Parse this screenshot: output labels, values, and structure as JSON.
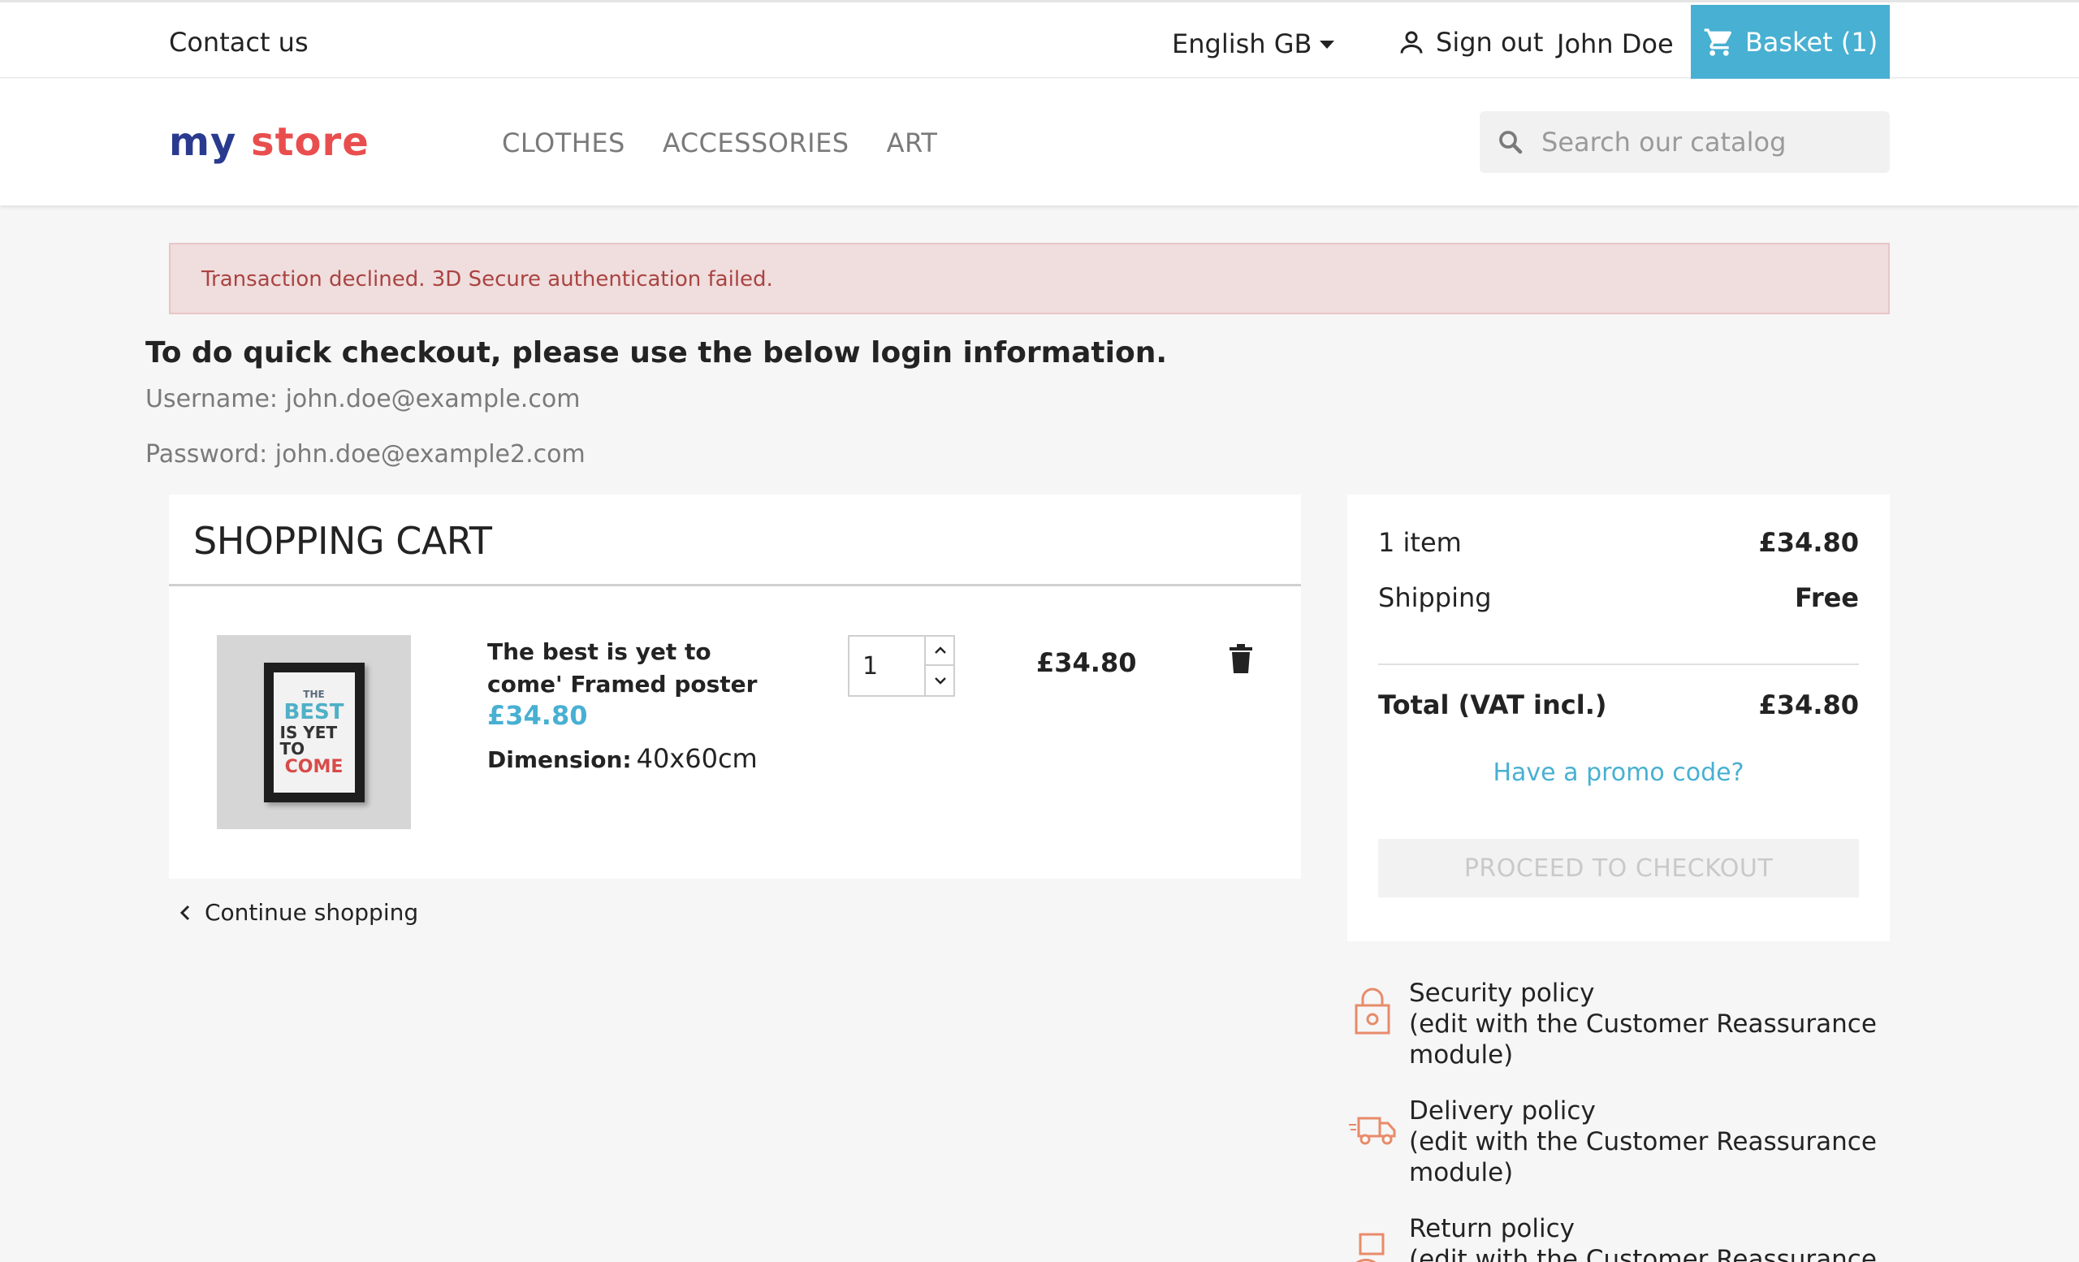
{
  "topbar": {
    "contact": "Contact us",
    "language": "English GB",
    "sign_out": "Sign out",
    "user_name": "John Doe",
    "basket": "Basket (1)"
  },
  "header": {
    "logo_part1": "my",
    "logo_part2": "store",
    "nav": [
      "CLOTHES",
      "ACCESSORIES",
      "ART"
    ],
    "search_placeholder": "Search our catalog"
  },
  "alert": {
    "message": "Transaction declined. 3D Secure authentication failed."
  },
  "quick_checkout": {
    "title": "To do quick checkout, please use the below login information.",
    "username": "Username: john.doe@example.com",
    "password": "Password: john.doe@example2.com"
  },
  "cart": {
    "title": "SHOPPING CART",
    "item": {
      "name": "The best is yet to come' Framed poster",
      "price": "£34.80",
      "dimension_label": "Dimension:",
      "dimension_value": "40x60cm",
      "quantity": "1",
      "line_total": "£34.80",
      "image_lines": [
        "THE",
        "BEST",
        "IS YET TO",
        "COME"
      ]
    },
    "continue": "Continue shopping"
  },
  "summary": {
    "items_label": "1 item",
    "items_value": "£34.80",
    "shipping_label": "Shipping",
    "shipping_value": "Free",
    "total_label": "Total (VAT incl.)",
    "total_value": "£34.80",
    "promo": "Have a promo code?",
    "checkout": "PROCEED TO CHECKOUT"
  },
  "reassurance": [
    {
      "title": "Security policy",
      "text": "(edit with the Customer Reassurance module)",
      "icon": "lock-icon"
    },
    {
      "title": "Delivery policy",
      "text": "(edit with the Customer Reassurance module)",
      "icon": "truck-icon"
    },
    {
      "title": "Return policy",
      "text": "(edit with the Customer Reassurance module)",
      "icon": "return-box-icon"
    }
  ],
  "colors": {
    "accent": "#48b0d2",
    "alert_bg": "#f0dddd",
    "alert_text": "#a94442",
    "reassurance_icon": "#e88b6a"
  }
}
